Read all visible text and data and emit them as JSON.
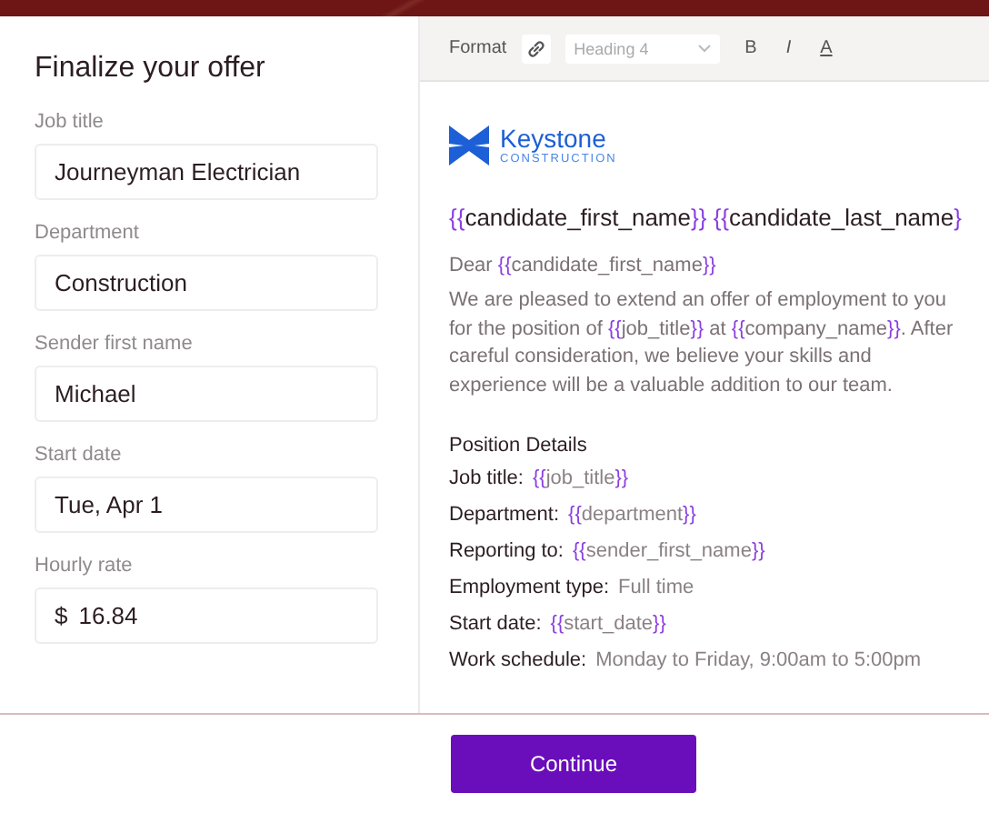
{
  "title": "Finalize your offer",
  "fields": [
    {
      "label": "Job title",
      "value": "Journeyman Electrician"
    },
    {
      "label": "Department",
      "value": "Construction"
    },
    {
      "label": "Sender first name",
      "value": "Michael"
    },
    {
      "label": "Start date",
      "value": "Tue, Apr 1"
    },
    {
      "label": "Hourly rate",
      "prefix": "$",
      "value": "16.84"
    }
  ],
  "toolbar": {
    "label": "Format",
    "style_select": "Heading 4",
    "buttons": [
      {
        "kind": "bold",
        "text": "B"
      },
      {
        "kind": "italic",
        "text": "I"
      },
      {
        "kind": "color",
        "text": "A"
      }
    ]
  },
  "letter": {
    "logo": {
      "name": "Keystone",
      "tagline": "CONSTRUCTION"
    },
    "recipient": "{{candidate_first_name}}  {{candidate_last_name}",
    "greeting": "Dear {{candidate_first_name}}",
    "body": "We are pleased to extend an offer of employment to you for the position of {{job_title}} at {{company_name}}. After careful consideration, we believe your skills and experience will be a valuable addition to our team.",
    "section_title": "Position Details",
    "details": [
      {
        "label": "Job title:",
        "value": "{{job_title}}"
      },
      {
        "label": "Department:",
        "value": "{{department}}"
      },
      {
        "label": "Reporting to:",
        "value": "{{sender_first_name}}"
      },
      {
        "label": "Employment type:",
        "value": "Full time"
      },
      {
        "label": "Start date:",
        "value": "{{start_date}}"
      },
      {
        "label": "Work schedule:",
        "value": "Monday to Friday, 9:00am to 5:00pm"
      }
    ]
  },
  "continue_button": "Continue"
}
